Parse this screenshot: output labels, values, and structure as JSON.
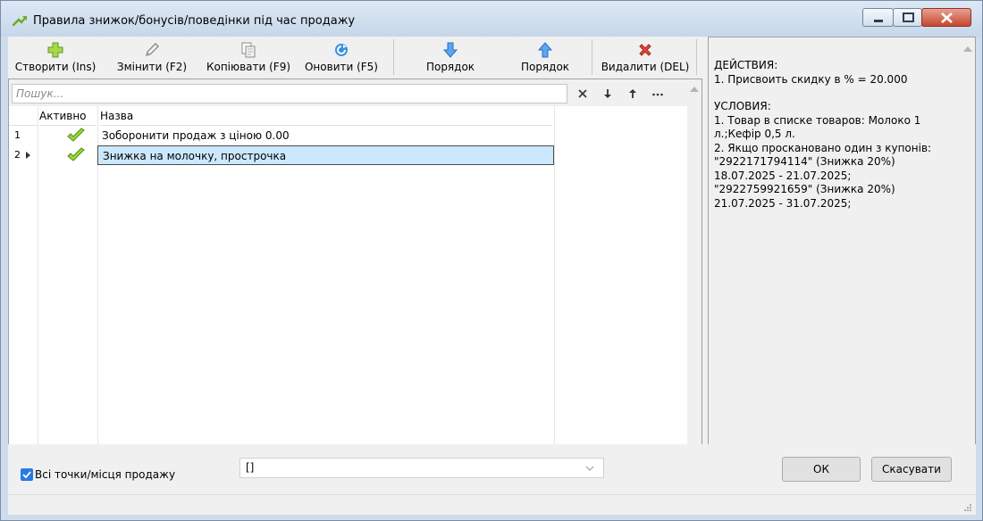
{
  "window": {
    "title": "Правила знижок/бонусів/поведінки під час продажу"
  },
  "toolbar": {
    "create": "Створити (Ins)",
    "edit": "Змінити (F2)",
    "copy": "Копіювати (F9)",
    "refresh": "Оновити (F5)",
    "order_down": "Порядок",
    "order_up": "Порядок",
    "delete": "Видалити (DEL)"
  },
  "search": {
    "placeholder": "Пошук..."
  },
  "table": {
    "columns": [
      "Активно",
      "Назва"
    ],
    "rows": [
      {
        "num": "1",
        "active": true,
        "name": "Зоборонити продаж з ціною 0.00"
      },
      {
        "num": "2",
        "active": true,
        "name": "Знижка на молочку, прострочка"
      }
    ]
  },
  "info": {
    "actions_title": "ДЕЙСТВИЯ:",
    "actions": [
      "1. Присвоить скидку в % = 20.000"
    ],
    "conditions_title": "УСЛОВИЯ:",
    "conditions": [
      "1. Товар в списке товаров: Молоко 1 л.;Кефір 0,5 л.",
      "2. Якщо проскановано один з купонів: \"2922171794114\" (Знижка 20%) 18.07.2025 - 21.07.2025; \"2922759921659\" (Знижка 20%) 21.07.2025 - 31.07.2025;"
    ]
  },
  "bottom": {
    "all_points_label": "Всі точки/місця продажу",
    "all_points_checked": true,
    "combo_value": "[]",
    "ok": "ОК",
    "cancel": "Скасувати"
  },
  "colors": {
    "accent": "#2a7ae2",
    "selection": "#cce8ff",
    "check_green": "#7cc21e"
  }
}
